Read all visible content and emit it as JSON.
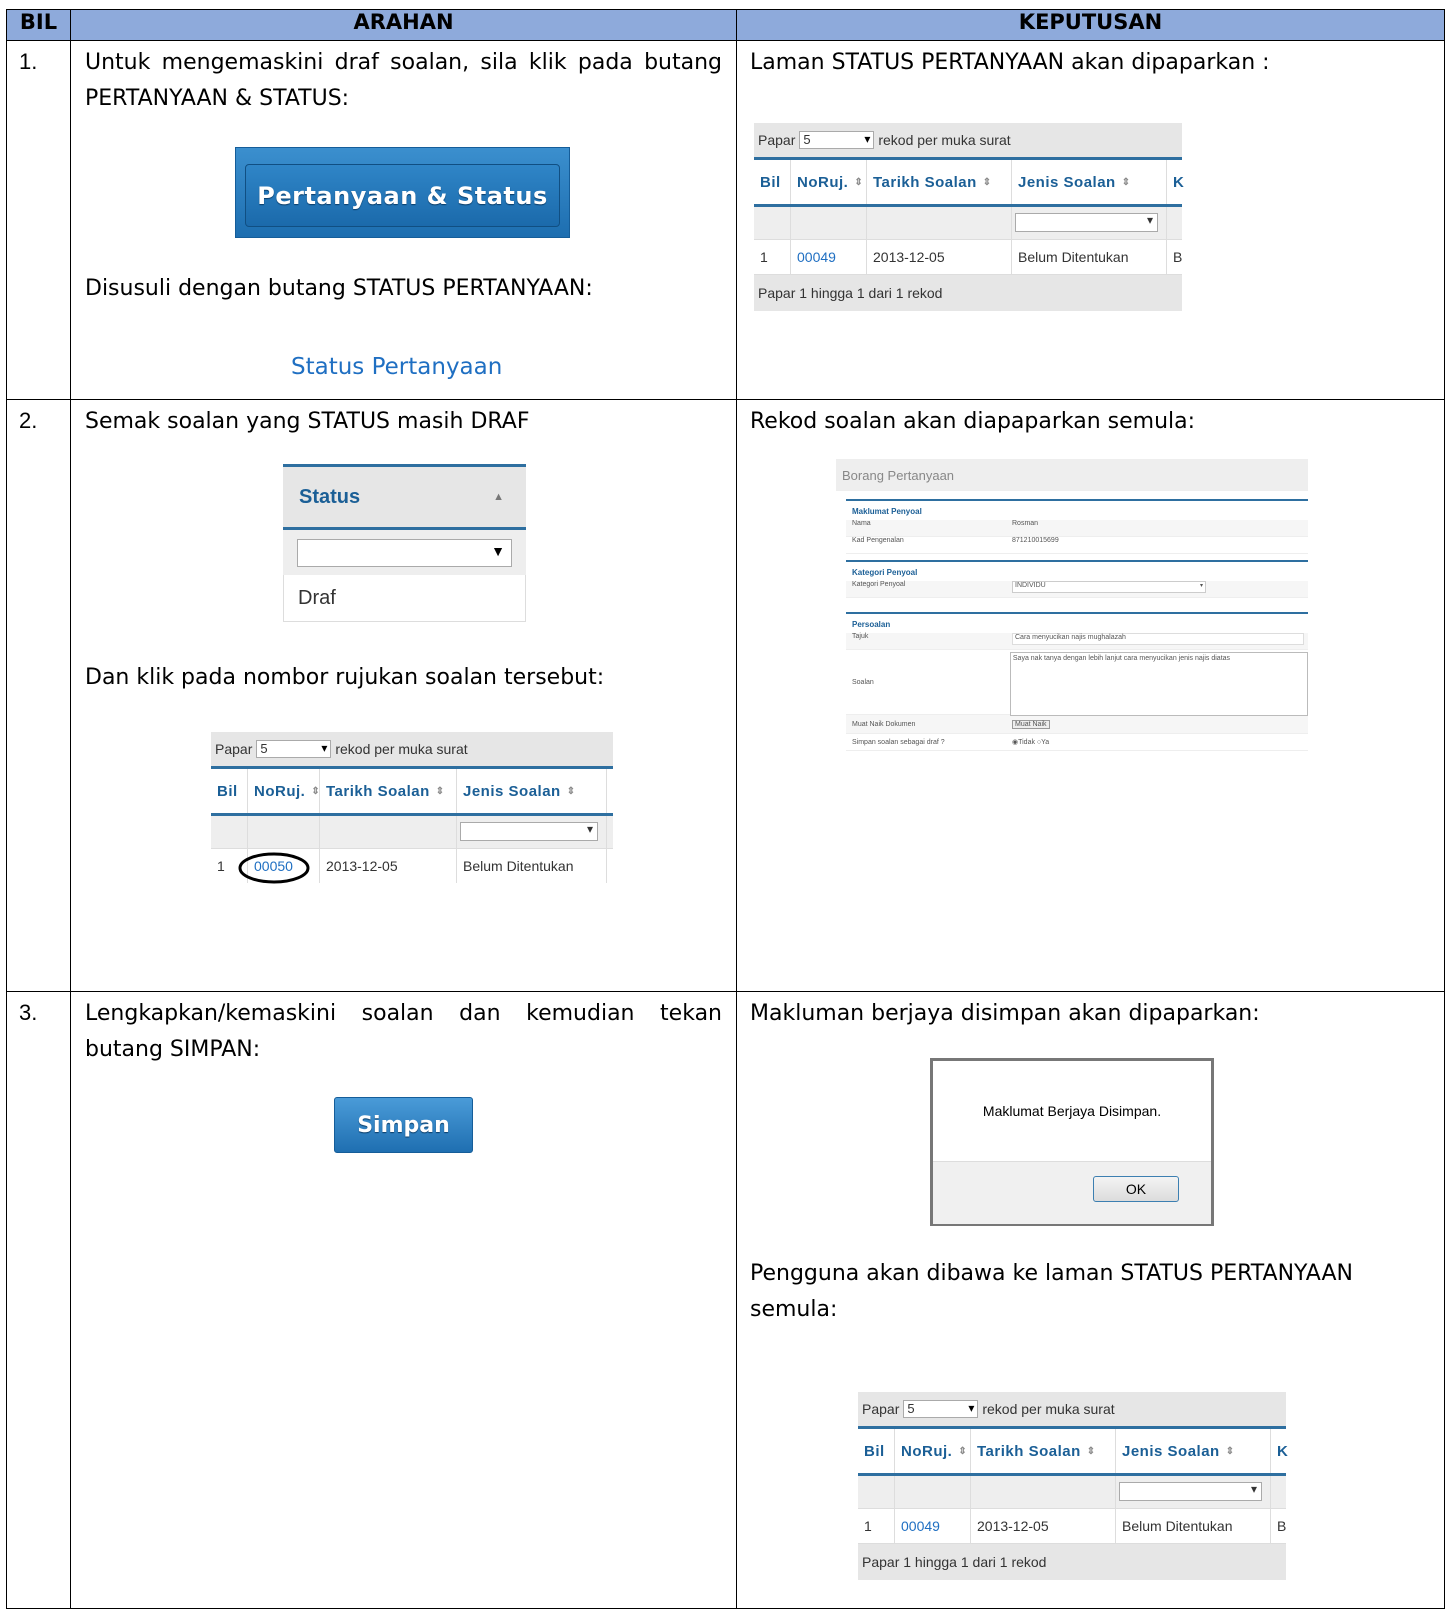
{
  "headers": {
    "bil": "BIL",
    "arahan": "ARAHAN",
    "keputusan": "KEPUTUSAN"
  },
  "rows": [
    {
      "bil": "1.",
      "arahan": {
        "text1": "Untuk mengemaskini draf soalan, sila klik pada butang PERTANYAAN & STATUS:",
        "button": "Pertanyaan & Status",
        "text2": "Disusuli dengan butang STATUS PERTANYAAN:",
        "link": "Status Pertanyaan"
      },
      "keputusan": {
        "text1": "Laman STATUS PERTANYAAN akan dipaparkan :"
      }
    },
    {
      "bil": "2.",
      "arahan": {
        "text1": "Semak soalan yang STATUS masih DRAF",
        "status_header": "Status",
        "status_value": "Draf",
        "text2": "Dan klik pada nombor rujukan soalan tersebut:"
      },
      "keputusan": {
        "text1": "Rekod soalan akan diapaparkan semula:"
      }
    },
    {
      "bil": "3.",
      "arahan": {
        "text1": "Lengkapkan/kemaskini soalan dan kemudian tekan butang SIMPAN:",
        "button": "Simpan"
      },
      "keputusan": {
        "text1": "Makluman berjaya disimpan akan dipaparkan:",
        "dialog_message": "Maklumat Berjaya Disimpan.",
        "dialog_ok": "OK",
        "text2": "Pengguna akan dibawa ke laman STATUS PERTANYAAN semula:"
      }
    }
  ],
  "grid": {
    "papar": "Papar",
    "per_page": "5",
    "per_page_suffix": "rekod per muka surat",
    "col_bil": "Bil",
    "col_noruj": "NoRuj.",
    "col_tarikh": "Tarikh Soalan",
    "col_jenis": "Jenis Soalan",
    "col_k": "K",
    "row_no": "1",
    "row_date": "2013-12-05",
    "row_jenis": "Belum Ditentukan",
    "row_k": "B",
    "ref_a": "00049",
    "ref_b": "00050",
    "footer": "Papar 1 hingga 1 dari 1 rekod"
  },
  "form": {
    "title": "Borang Pertanyaan",
    "sec1": "Maklumat Penyoal",
    "nama_label": "Nama",
    "nama_value": "Rosman",
    "kp_label": "Kad Pengenalan",
    "kp_value": "871210015699",
    "sec2": "Kategori Penyoal",
    "kat_label": "Kategori Penyoal",
    "kat_value": "INDIVIDU",
    "sec3": "Persoalan",
    "tajuk_label": "Tajuk",
    "tajuk_value": "Cara menyucikan najis mughalazah",
    "soalan_label": "Soalan",
    "soalan_value": "Saya nak tanya dengan lebih lanjut cara menyucikan jenis najis diatas",
    "muat_label": "Muat Naik Dokumen",
    "muat_button": "Muat Naik",
    "simpan_label": "Simpan soalan sebagai draf ?",
    "opt_tidak": "Tidak",
    "opt_ya": "Ya"
  }
}
